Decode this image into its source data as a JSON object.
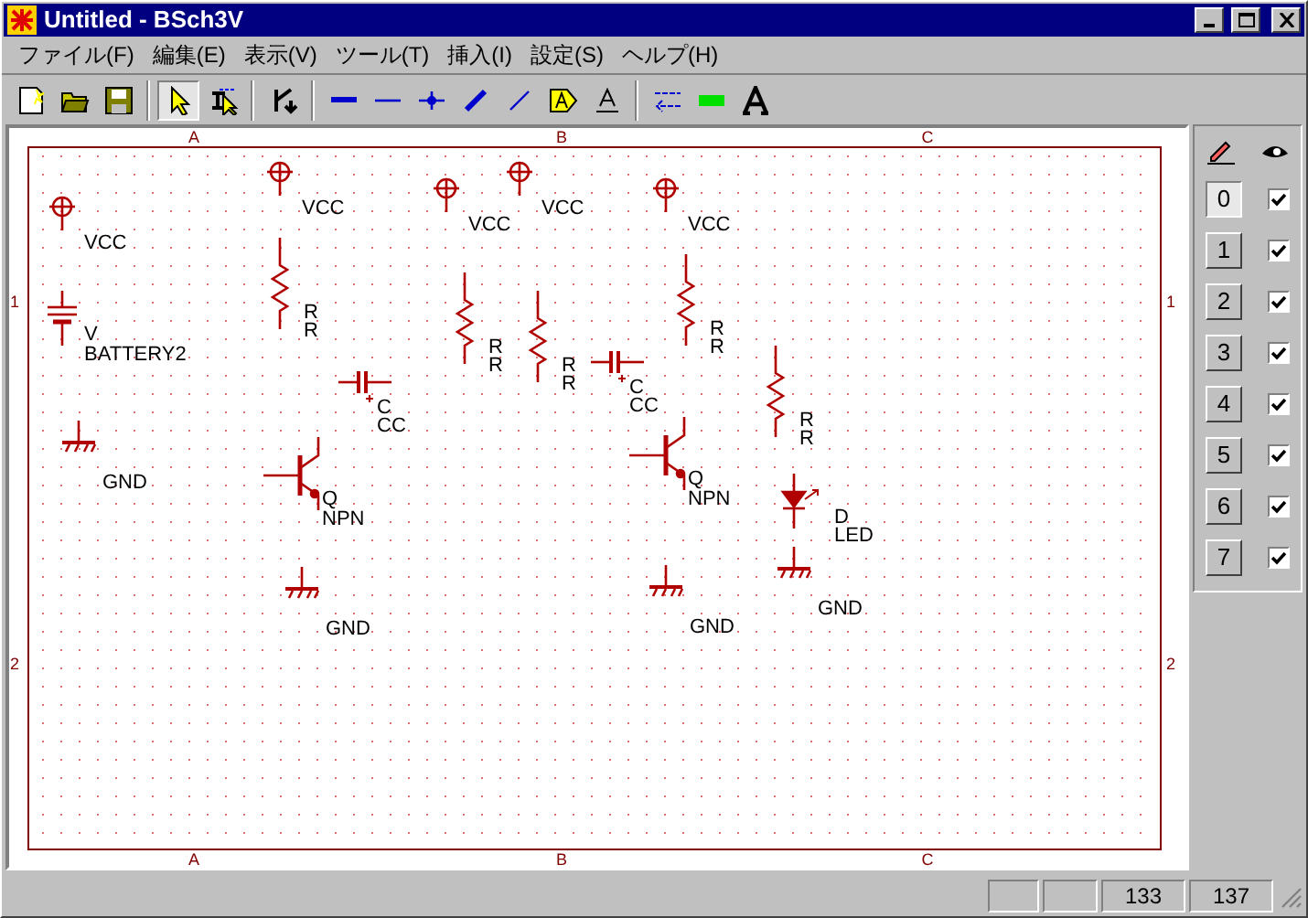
{
  "window": {
    "title": "Untitled - BSch3V"
  },
  "menu": [
    "ファイル(F)",
    "編集(E)",
    "表示(V)",
    "ツール(T)",
    "挿入(I)",
    "設定(S)",
    "ヘルプ(H)"
  ],
  "toolbar": [
    {
      "kind": "new",
      "selected": false
    },
    {
      "kind": "open",
      "selected": false
    },
    {
      "kind": "save",
      "selected": false
    },
    {
      "kind": "separator"
    },
    {
      "kind": "select",
      "selected": true
    },
    {
      "kind": "drag",
      "selected": false
    },
    {
      "kind": "separator"
    },
    {
      "kind": "tag",
      "selected": false
    },
    {
      "kind": "separator"
    },
    {
      "kind": "bus",
      "selected": false
    },
    {
      "kind": "wire",
      "selected": false
    },
    {
      "kind": "junction",
      "selected": false
    },
    {
      "kind": "bus_entry",
      "selected": false
    },
    {
      "kind": "entry",
      "selected": false
    },
    {
      "kind": "label",
      "selected": false
    },
    {
      "kind": "comment",
      "selected": false
    },
    {
      "kind": "separator"
    },
    {
      "kind": "dash",
      "selected": false
    },
    {
      "kind": "marker",
      "selected": false
    },
    {
      "kind": "text",
      "selected": false
    }
  ],
  "sheet": {
    "top_columns": [
      "A",
      "B",
      "C"
    ],
    "bottom_columns": [
      "A",
      "B",
      "C"
    ],
    "left_rows": [
      "1",
      "2"
    ],
    "right_rows": [
      "1",
      "2"
    ]
  },
  "components": [
    {
      "kind": "vcc",
      "labels": [
        "VCC"
      ]
    },
    {
      "kind": "battery",
      "labels": [
        "V",
        "BATTERY2"
      ]
    },
    {
      "kind": "gnd",
      "labels": [
        "GND"
      ]
    },
    {
      "kind": "vcc",
      "labels": [
        "VCC"
      ]
    },
    {
      "kind": "resistor",
      "labels": [
        "R",
        "R"
      ]
    },
    {
      "kind": "capacitor",
      "labels": [
        "C",
        "CC"
      ]
    },
    {
      "kind": "npn",
      "labels": [
        "Q",
        "NPN"
      ]
    },
    {
      "kind": "gnd",
      "labels": [
        "GND"
      ]
    },
    {
      "kind": "vcc",
      "labels": [
        "VCC"
      ]
    },
    {
      "kind": "resistor",
      "labels": [
        "R",
        "R"
      ]
    },
    {
      "kind": "vcc",
      "labels": [
        "VCC"
      ]
    },
    {
      "kind": "resistor",
      "labels": [
        "R",
        "R"
      ]
    },
    {
      "kind": "capacitor",
      "labels": [
        "C",
        "CC"
      ]
    },
    {
      "kind": "vcc",
      "labels": [
        "VCC"
      ]
    },
    {
      "kind": "resistor",
      "labels": [
        "R",
        "R"
      ]
    },
    {
      "kind": "npn",
      "labels": [
        "Q",
        "NPN"
      ]
    },
    {
      "kind": "gnd",
      "labels": [
        "GND"
      ]
    },
    {
      "kind": "resistor",
      "labels": [
        "R",
        "R"
      ]
    },
    {
      "kind": "led",
      "labels": [
        "D",
        "LED"
      ]
    },
    {
      "kind": "gnd",
      "labels": [
        "GND"
      ]
    }
  ],
  "layers": [
    {
      "label": "0",
      "selected": true,
      "visible": true
    },
    {
      "label": "1",
      "selected": false,
      "visible": true
    },
    {
      "label": "2",
      "selected": false,
      "visible": true
    },
    {
      "label": "3",
      "selected": false,
      "visible": true
    },
    {
      "label": "4",
      "selected": false,
      "visible": true
    },
    {
      "label": "5",
      "selected": false,
      "visible": true
    },
    {
      "label": "6",
      "selected": false,
      "visible": true
    },
    {
      "label": "7",
      "selected": false,
      "visible": true
    }
  ],
  "status_bar": {
    "cells": [
      "133",
      "137"
    ]
  }
}
